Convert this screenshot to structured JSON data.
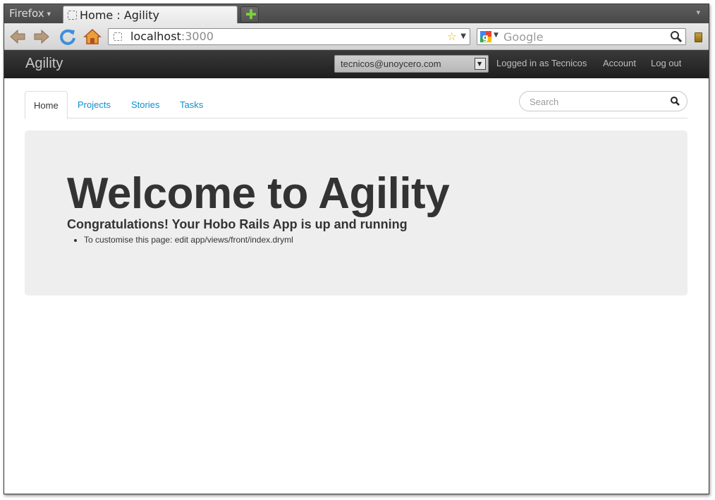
{
  "browser": {
    "menu_label": "Firefox",
    "tab_title": "Home : Agility",
    "url_host": "localhost",
    "url_port": ":3000",
    "search_engine": "Google",
    "search_placeholder": "Google"
  },
  "app": {
    "brand": "Agility",
    "user_select_value": "tecnicos@unoycero.com",
    "logged_in_text": "Logged in as Tecnicos",
    "account_label": "Account",
    "logout_label": "Log out"
  },
  "nav_tabs": [
    {
      "label": "Home",
      "active": true
    },
    {
      "label": "Projects",
      "active": false
    },
    {
      "label": "Stories",
      "active": false
    },
    {
      "label": "Tasks",
      "active": false
    }
  ],
  "site_search": {
    "placeholder": "Search"
  },
  "hero": {
    "title": "Welcome to Agility",
    "subtitle": "Congratulations! Your Hobo Rails App is up and running",
    "items": [
      "To customise this page: edit app/views/front/index.dryml"
    ]
  },
  "colors": {
    "link": "#0d8fd0",
    "appbar": "#2a2a2a",
    "hero_bg": "#eeeeee"
  }
}
